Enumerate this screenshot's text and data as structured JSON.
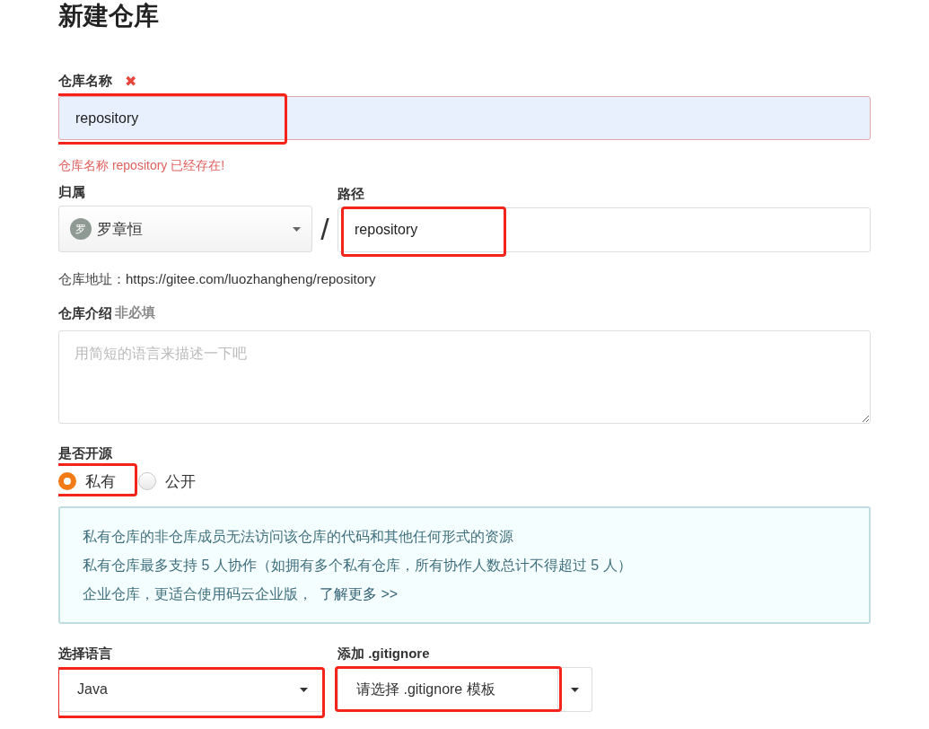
{
  "title": "新建仓库",
  "name_field": {
    "label": "仓库名称",
    "required_mark": "✖",
    "value": "repository",
    "invalid": true,
    "highlighted": true,
    "error": "仓库名称 repository 已经存在!"
  },
  "owner": {
    "label": "归属",
    "avatar": "罗",
    "value": "罗章恒"
  },
  "separator": "/",
  "path": {
    "label": "路径",
    "value": "repository",
    "highlighted": true
  },
  "address": {
    "label": "仓库地址：",
    "url": "https://gitee.com/luozhangheng/repository"
  },
  "description": {
    "label": "仓库介绍",
    "note": "非必填",
    "placeholder": "用简短的语言来描述一下吧"
  },
  "visibility": {
    "label": "是否开源",
    "options": [
      {
        "label": "私有",
        "selected": true,
        "highlighted": true
      },
      {
        "label": "公开",
        "selected": false,
        "highlighted": false
      }
    ]
  },
  "info": {
    "lines": [
      "私有仓库的非仓库成员无法访问该仓库的代码和其他任何形式的资源",
      "私有仓库最多支持 5 人协作（如拥有多个私有仓库，所有协作人数总计不得超过 5 人）"
    ],
    "enterprise_text": "企业仓库，更适合使用码云企业版，",
    "enterprise_link": "了解更多 >>"
  },
  "language": {
    "label": "选择语言",
    "value": "Java",
    "highlighted": true
  },
  "gitignore": {
    "label": "添加 .gitignore",
    "value": "请选择 .gitignore 模板",
    "highlighted": true
  }
}
